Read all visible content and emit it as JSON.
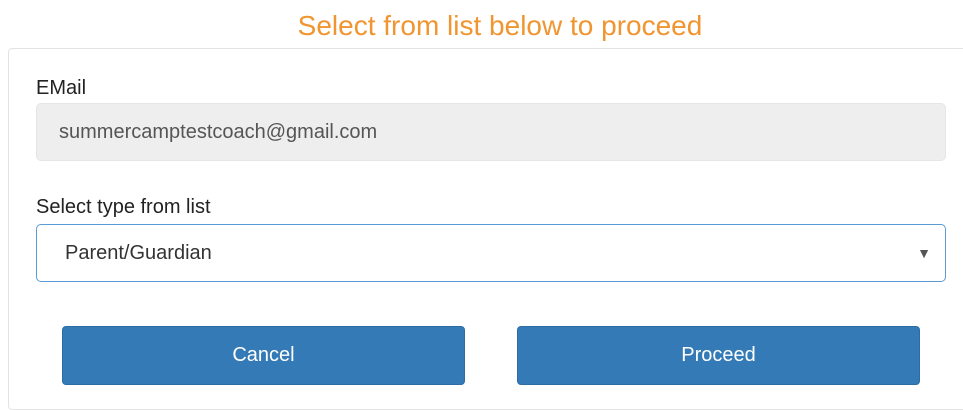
{
  "heading": "Select from list below to proceed",
  "form": {
    "email_label": "EMail",
    "email_value": "summercamptestcoach@gmail.com",
    "type_label": "Select type from list",
    "type_selected": "Parent/Guardian",
    "type_icon": "chevron-down-icon"
  },
  "actions": {
    "cancel_label": "Cancel",
    "proceed_label": "Proceed"
  },
  "colors": {
    "heading": "#f0952f",
    "button": "#337ab7",
    "select_border": "#5b9bd5",
    "readonly_field": "#eeeeee"
  }
}
